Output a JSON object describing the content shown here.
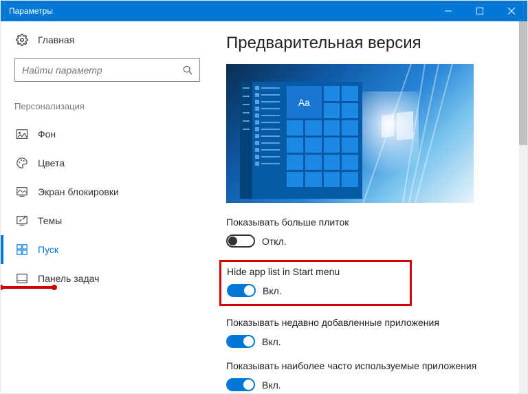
{
  "window": {
    "title": "Параметры"
  },
  "sidebar": {
    "home": "Главная",
    "search_placeholder": "Найти параметр",
    "category": "Персонализация",
    "items": [
      {
        "label": "Фон"
      },
      {
        "label": "Цвета"
      },
      {
        "label": "Экран блокировки"
      },
      {
        "label": "Темы"
      },
      {
        "label": "Пуск"
      },
      {
        "label": "Панель задач"
      }
    ]
  },
  "content": {
    "title": "Предварительная версия",
    "preview_tile_text": "Aa",
    "settings": [
      {
        "label": "Показывать больше плиток",
        "state_text": "Откл.",
        "on": false
      },
      {
        "label": "Hide app list in Start menu",
        "state_text": "Вкл.",
        "on": true
      },
      {
        "label": "Показывать недавно добавленные приложения",
        "state_text": "Вкл.",
        "on": true
      },
      {
        "label": "Показывать наиболее часто используемые приложения",
        "state_text": "Вкл.",
        "on": true
      }
    ]
  }
}
